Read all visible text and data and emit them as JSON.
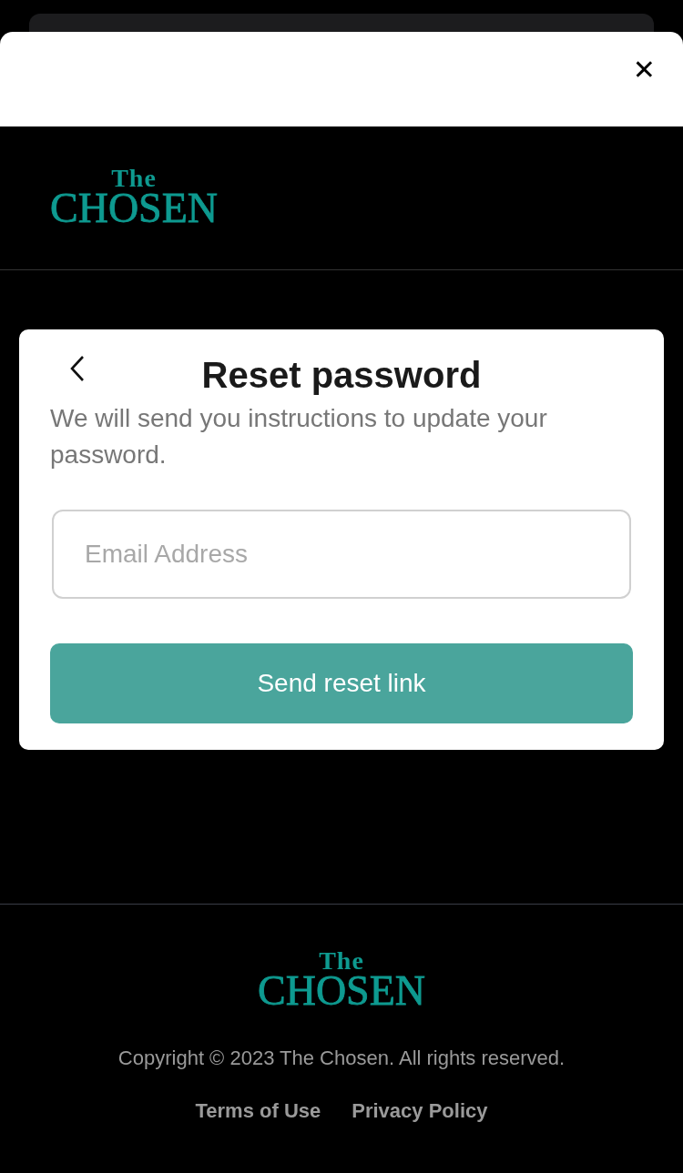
{
  "sheet": {
    "close_icon": "✕"
  },
  "header": {
    "logo": {
      "small": "The",
      "large": "CHOSEN"
    }
  },
  "card": {
    "title": "Reset password",
    "description": "We will send you instructions to update your password.",
    "email_field": {
      "placeholder": "Email Address"
    },
    "submit_button": "Send reset link"
  },
  "footer": {
    "logo": {
      "small": "The",
      "large": "CHOSEN"
    },
    "copyright": "Copyright © 2023 The Chosen. All rights reserved.",
    "links": [
      "Terms of Use",
      "Privacy Policy"
    ]
  }
}
